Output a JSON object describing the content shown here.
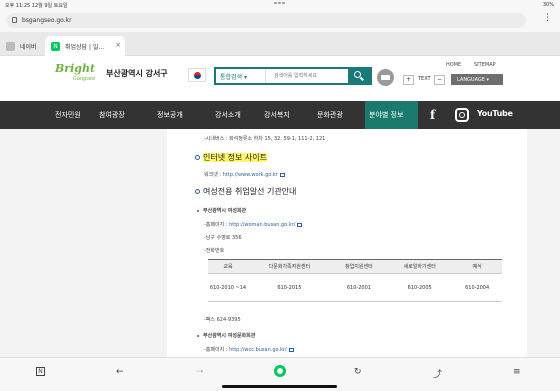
{
  "status": {
    "time": "오후 11:25",
    "date": "12월 9일 토요일",
    "right": "30%"
  },
  "browser": {
    "url": "bsgangseo.go.kr"
  },
  "tabs": [
    {
      "label": "네이버"
    },
    {
      "label": "취업상담 | 일...",
      "icon": "N"
    }
  ],
  "site": {
    "logo_bright": "Bright",
    "logo_gangseo": "Gangseo",
    "logo_name": "부산광역시 강서구",
    "search_scope": "통합검색",
    "search_placeholder": "검색어를 입력하세요",
    "home": "HOME",
    "sitemap": "SITEMAP",
    "plus": "+",
    "text": "TEXT",
    "minus": "−",
    "language": "LANGUAGE"
  },
  "nav": [
    "전자민원",
    "참여광장",
    "정보공개",
    "강서소개",
    "강서복지",
    "문화관광",
    "분야별 정보"
  ],
  "content": {
    "bus_line": "-시내버스 : 화석정류소 하차 15, 32, 59-1, 111-2, 121",
    "h_internet": "인터넷 정보 사이트",
    "worknet": "워크넷 : ",
    "worknet_url": "http://www.work.go.kr",
    "h_women": "여성전용 취업알선 기관안내",
    "org1": "부산광역시 여성회관",
    "homepage_label": "-홈페이지 : ",
    "org1_url": "http://woman.busan.go.kr/",
    "org1_addr": "-남구 수영로 356",
    "phone_label": "-전화번호",
    "table": {
      "headers": [
        "교육",
        "다문화가족지원센터",
        "창업지원센터",
        "새로일하기센터",
        "예식"
      ],
      "row": [
        "610-2010 ~14",
        "610-2015",
        "610-2001",
        "610-2005",
        "610-2004"
      ]
    },
    "fax": "-팩스 624-9395",
    "org2": "부산광역시 여성문화회관",
    "org2_url": "http://wcc.busan.go.kr/"
  },
  "social": {
    "facebook": "f",
    "youtube": "YouTube"
  },
  "toolbar": {
    "n": "N",
    "back": "←",
    "forward": "→",
    "refresh": "↻",
    "share": "⤴",
    "menu": "≡"
  }
}
